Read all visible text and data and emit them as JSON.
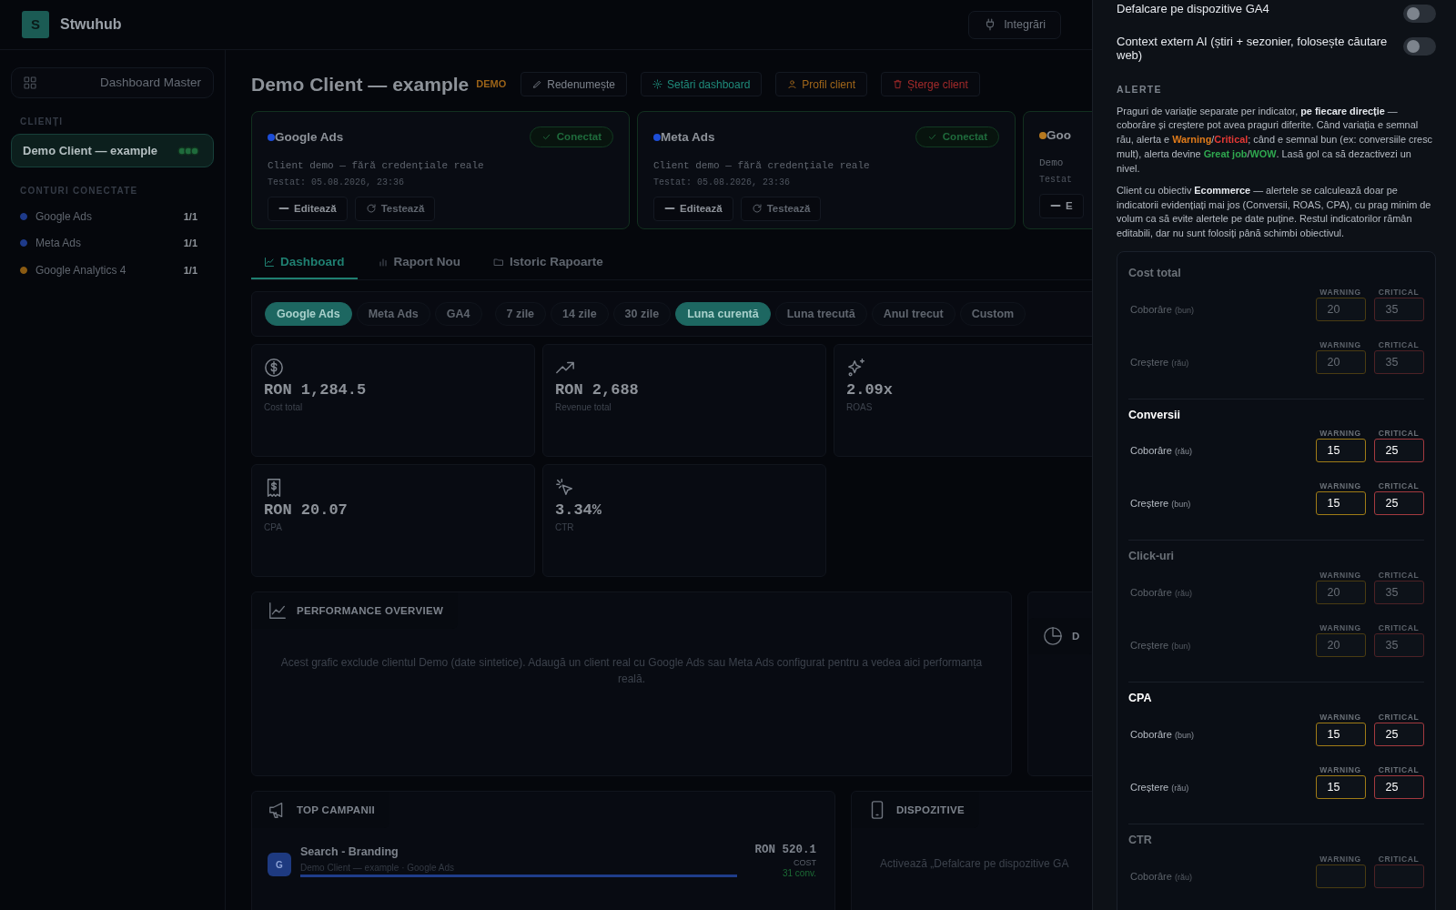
{
  "brand": {
    "logo_letter": "S",
    "name": "Stwuhub"
  },
  "header_buttons": [
    {
      "label": "Integrări",
      "kind": "plug"
    }
  ],
  "sidebar": {
    "master": "Dashboard Master",
    "clients_heading": "CLIENȚI",
    "clients": [
      {
        "name": "Demo Client — example",
        "selected": true
      }
    ],
    "accounts_heading": "CONTURI CONECTATE",
    "accounts": [
      {
        "name": "Google Ads",
        "count": "1/1",
        "color": "#1e3a8a"
      },
      {
        "name": "Meta Ads",
        "count": "1/1",
        "color": "#1e3a8a"
      },
      {
        "name": "Google Analytics 4",
        "count": "1/1",
        "color": "#8a5a12"
      }
    ]
  },
  "client": {
    "title": "Demo Client — example",
    "badge": "DEMO",
    "actions": [
      {
        "label": "Redenumește",
        "kind": "rename"
      },
      {
        "label": "Setări dashboard",
        "kind": "settings"
      },
      {
        "label": "Profil client",
        "kind": "profile"
      },
      {
        "label": "Șterge client",
        "kind": "delete"
      }
    ]
  },
  "connections": [
    {
      "name": "Google Ads",
      "color": "#1d4ed8",
      "status": "Conectat",
      "description": "Client demo — fără credențiale reale",
      "tested": "Testat: 05.08.2026, 23:36",
      "buttons": [
        {
          "label": "Editează",
          "kind": "edit"
        },
        {
          "label": "Testează",
          "kind": "test"
        }
      ]
    },
    {
      "name": "Meta Ads",
      "color": "#1d4ed8",
      "status": "Conectat",
      "description": "Client demo — fără credențiale reale",
      "tested": "Testat: 05.08.2026, 23:36",
      "buttons": [
        {
          "label": "Editează",
          "kind": "edit"
        },
        {
          "label": "Testează",
          "kind": "test"
        }
      ]
    },
    {
      "name": "Goo",
      "color": "#b7791f",
      "description": "Demo",
      "tested": "Testat",
      "buttons": [
        {
          "label": "E",
          "kind": "edit"
        }
      ]
    }
  ],
  "tabs": [
    {
      "label": "Dashboard",
      "kind": "chart",
      "selected": true
    },
    {
      "label": "Raport Nou",
      "kind": "bars",
      "selected": false
    },
    {
      "label": "Istoric Rapoarte",
      "kind": "folder",
      "selected": false
    }
  ],
  "filters": {
    "sources": [
      {
        "label": "Google Ads",
        "selected": true
      },
      {
        "label": "Meta Ads",
        "selected": false
      },
      {
        "label": "GA4",
        "selected": false
      }
    ],
    "periods": [
      {
        "label": "7 zile",
        "selected": false
      },
      {
        "label": "14 zile",
        "selected": false
      },
      {
        "label": "30 zile",
        "selected": false
      },
      {
        "label": "Luna curentă",
        "selected": true
      },
      {
        "label": "Luna trecută",
        "selected": false
      },
      {
        "label": "Anul trecut",
        "selected": false
      },
      {
        "label": "Custom",
        "selected": false
      }
    ]
  },
  "metrics": [
    {
      "kind": "cost",
      "value": "RON 1,284.5",
      "label": "Cost total"
    },
    {
      "kind": "revenue",
      "value": "RON 2,688",
      "label": "Revenue total"
    },
    {
      "kind": "roas",
      "value": "2.09x",
      "label": "ROAS"
    },
    {
      "kind": "cpa",
      "value": "RON 20.07",
      "label": "CPA"
    },
    {
      "kind": "ctr",
      "value": "3.34%",
      "label": "CTR"
    }
  ],
  "performance": {
    "title": "PERFORMANCE OVERVIEW",
    "message": "Acest grafic exclude clientul Demo (date sintetice). Adaugă un client real cu Google Ads sau Meta Ads configurat pentru a vedea aici performanța reală."
  },
  "distribution": {
    "title": "D"
  },
  "top_campaigns": {
    "title": "TOP CAMPANII",
    "items": [
      {
        "badge": "G",
        "name": "Search - Branding",
        "subtitle": "Demo Client — example · Google Ads",
        "level": 1,
        "amount": "RON 520.1",
        "amount_label": "COST",
        "conversions": "31 conv."
      }
    ]
  },
  "devices": {
    "title": "DISPOZITIVE",
    "message": "Activează „Defalcare pe dispozitive GA"
  },
  "panel": {
    "toggles": [
      {
        "label": "Defalcare pe dispozitive GA4",
        "on": false
      },
      {
        "label": "Context extern AI (știri + sezonier, folosește căutare web)",
        "on": false
      }
    ],
    "alerts_heading": "ALERTE",
    "paragraphs": [
      {
        "text": "Praguri de variație separate per indicator, **pe fiecare direcție** — coborâre și creștere pot avea praguri diferite. Când variația e semnal rău, alerta e **Warning**/**Critical**; când e semnal bun (ex: conversiile cresc mult), alerta devine **Great job**/**WOW**. Lasă gol ca să dezactivezi un nivel.",
        "highlights": [
          {
            "color": "#e6e9ee"
          },
          {
            "color": "#e07b1a"
          },
          {
            "color": "#e53935"
          },
          {
            "color": "#2fa84f"
          },
          {
            "color": "#2fa84f"
          }
        ]
      },
      {
        "text": "Client cu obiectiv **Ecommerce** — alertele se calculează doar pe indicatorii evidențiați mai jos (Conversii, ROAS, CPA), cu prag minim de volum ca să evite alertele pe date puține. Restul indicatorilor rămân editabili, dar nu sunt folosiți până schimbi obiectivul.",
        "highlights": [
          {
            "color": "#e6e9ee"
          }
        ]
      }
    ],
    "indicators": [
      {
        "name": "Cost total",
        "highlighted": false,
        "rows": [
          {
            "direction": "Coborâre",
            "hint": "(bun)",
            "warning_label": "WARNING",
            "critical_label": "CRITICAL",
            "warning": "20",
            "critical": "35"
          },
          {
            "direction": "Creștere",
            "hint": "(rău)",
            "warning_label": "WARNING",
            "critical_label": "CRITICAL",
            "warning": "20",
            "critical": "35"
          }
        ]
      },
      {
        "name": "Conversii",
        "highlighted": true,
        "rows": [
          {
            "direction": "Coborâre",
            "hint": "(rău)",
            "warning_label": "WARNING",
            "critical_label": "CRITICAL",
            "warning": "15",
            "critical": "25"
          },
          {
            "direction": "Creștere",
            "hint": "(bun)",
            "warning_label": "WARNING",
            "critical_label": "CRITICAL",
            "warning": "15",
            "critical": "25"
          }
        ]
      },
      {
        "name": "Click-uri",
        "highlighted": false,
        "rows": [
          {
            "direction": "Coborâre",
            "hint": "(rău)",
            "warning_label": "WARNING",
            "critical_label": "CRITICAL",
            "warning": "20",
            "critical": "35"
          },
          {
            "direction": "Creștere",
            "hint": "(bun)",
            "warning_label": "WARNING",
            "critical_label": "CRITICAL",
            "warning": "20",
            "critical": "35"
          }
        ]
      },
      {
        "name": "CPA",
        "highlighted": true,
        "rows": [
          {
            "direction": "Coborâre",
            "hint": "(bun)",
            "warning_label": "WARNING",
            "critical_label": "CRITICAL",
            "warning": "15",
            "critical": "25"
          },
          {
            "direction": "Creștere",
            "hint": "(rău)",
            "warning_label": "WARNING",
            "critical_label": "CRITICAL",
            "warning": "15",
            "critical": "25"
          }
        ]
      },
      {
        "name": "CTR",
        "highlighted": false,
        "rows": [
          {
            "direction": "Coborâre",
            "hint": "(rău)",
            "warning_label": "WARNING",
            "critical_label": "CRITICAL"
          }
        ]
      }
    ]
  }
}
